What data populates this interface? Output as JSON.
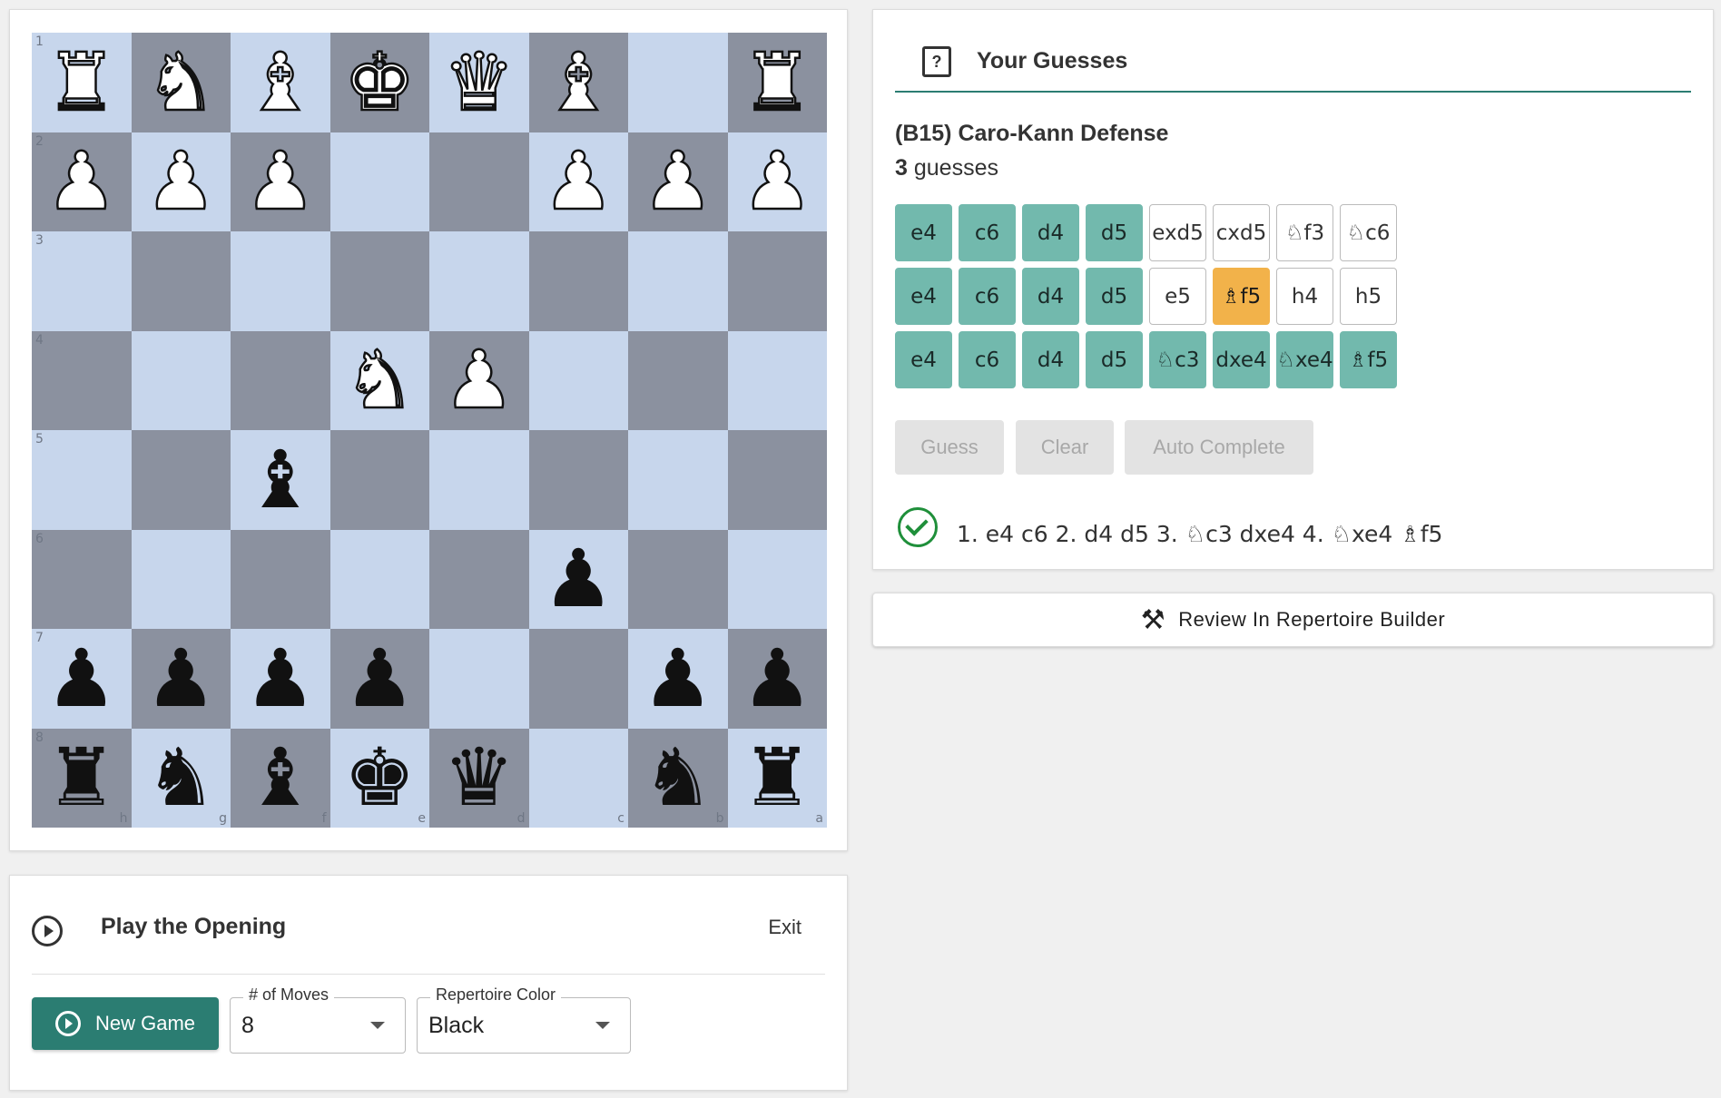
{
  "board": {
    "rank_labels": [
      "1",
      "2",
      "3",
      "4",
      "5",
      "6",
      "7",
      "8"
    ],
    "file_labels": [
      "h",
      "g",
      "f",
      "e",
      "d",
      "c",
      "b",
      "a"
    ],
    "rows": [
      [
        {
          "p": "♜",
          "c": "w"
        },
        {
          "p": "♞",
          "c": "w"
        },
        {
          "p": "♝",
          "c": "w"
        },
        {
          "p": "♚",
          "c": "w"
        },
        {
          "p": "♛",
          "c": "w"
        },
        {
          "p": "♝",
          "c": "w"
        },
        null,
        {
          "p": "♜",
          "c": "w"
        }
      ],
      [
        {
          "p": "♟",
          "c": "w"
        },
        {
          "p": "♟",
          "c": "w"
        },
        {
          "p": "♟",
          "c": "w"
        },
        null,
        null,
        {
          "p": "♟",
          "c": "w"
        },
        {
          "p": "♟",
          "c": "w"
        },
        {
          "p": "♟",
          "c": "w"
        }
      ],
      [
        null,
        null,
        null,
        null,
        null,
        null,
        null,
        null
      ],
      [
        null,
        null,
        null,
        {
          "p": "♞",
          "c": "w"
        },
        {
          "p": "♟",
          "c": "w"
        },
        null,
        null,
        null
      ],
      [
        null,
        null,
        {
          "p": "♝",
          "c": "b"
        },
        null,
        null,
        null,
        null,
        null
      ],
      [
        null,
        null,
        null,
        null,
        null,
        {
          "p": "♟",
          "c": "b"
        },
        null,
        null
      ],
      [
        {
          "p": "♟",
          "c": "b"
        },
        {
          "p": "♟",
          "c": "b"
        },
        {
          "p": "♟",
          "c": "b"
        },
        {
          "p": "♟",
          "c": "b"
        },
        null,
        null,
        {
          "p": "♟",
          "c": "b"
        },
        {
          "p": "♟",
          "c": "b"
        }
      ],
      [
        {
          "p": "♜",
          "c": "b"
        },
        {
          "p": "♞",
          "c": "b"
        },
        {
          "p": "♝",
          "c": "b"
        },
        {
          "p": "♚",
          "c": "b"
        },
        {
          "p": "♛",
          "c": "b"
        },
        null,
        {
          "p": "♞",
          "c": "b"
        },
        {
          "p": "♜",
          "c": "b"
        }
      ]
    ],
    "colors": {
      "light": "#c7d6ec",
      "dark": "#8b919f"
    }
  },
  "play": {
    "title": "Play the Opening",
    "exit_label": "Exit",
    "new_game_label": "New Game",
    "moves_label": "# of Moves",
    "moves_value": "8",
    "color_label": "Repertoire Color",
    "color_value": "Black"
  },
  "guesses": {
    "title": "Your Guesses",
    "opening": "(B15) Caro-Kann Defense",
    "count": "3",
    "count_suffix": " guesses",
    "rows": [
      [
        {
          "t": "e4",
          "s": "green"
        },
        {
          "t": "c6",
          "s": "green"
        },
        {
          "t": "d4",
          "s": "green"
        },
        {
          "t": "d5",
          "s": "green"
        },
        {
          "t": "exd5",
          "s": "white"
        },
        {
          "t": "cxd5",
          "s": "white"
        },
        {
          "t": "♘f3",
          "s": "white"
        },
        {
          "t": "♘c6",
          "s": "white"
        }
      ],
      [
        {
          "t": "e4",
          "s": "green"
        },
        {
          "t": "c6",
          "s": "green"
        },
        {
          "t": "d4",
          "s": "green"
        },
        {
          "t": "d5",
          "s": "green"
        },
        {
          "t": "e5",
          "s": "white"
        },
        {
          "t": "♗f5",
          "s": "yellow"
        },
        {
          "t": "h4",
          "s": "white"
        },
        {
          "t": "h5",
          "s": "white"
        }
      ],
      [
        {
          "t": "e4",
          "s": "green"
        },
        {
          "t": "c6",
          "s": "green"
        },
        {
          "t": "d4",
          "s": "green"
        },
        {
          "t": "d5",
          "s": "green"
        },
        {
          "t": "♘c3",
          "s": "green"
        },
        {
          "t": "dxe4",
          "s": "green"
        },
        {
          "t": "♘xe4",
          "s": "green"
        },
        {
          "t": "♗f5",
          "s": "green"
        }
      ]
    ],
    "guess_label": "Guess",
    "clear_label": "Clear",
    "auto_label": "Auto Complete",
    "solution": "1. e4 c6 2. d4 d5 3. ♘c3 dxe4 4. ♘xe4 ♗f5",
    "colors": {
      "green": "#72b9ad",
      "yellow": "#f2b24a",
      "accent": "#2b7d72"
    }
  },
  "review": {
    "label": "Review In Repertoire Builder",
    "icon": "hammer-wrench-icon"
  }
}
